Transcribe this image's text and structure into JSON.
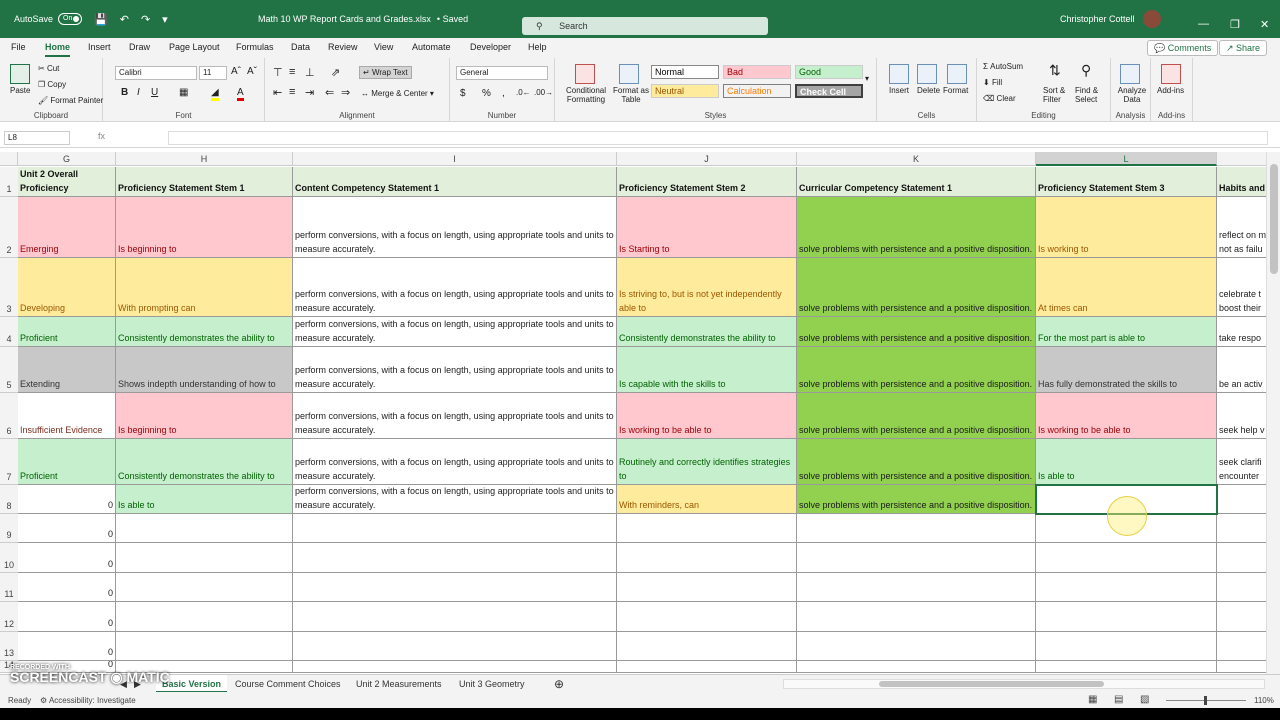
{
  "titlebar": {
    "autosave_label": "AutoSave",
    "autosave_state": "On",
    "file_title": "Math 10 WP Report Cards and Grades.xlsx",
    "saved_status": "• Saved",
    "search_placeholder": "Search",
    "user_name": "Christopher Cottell"
  },
  "menu": {
    "items": [
      "File",
      "Home",
      "Insert",
      "Draw",
      "Page Layout",
      "Formulas",
      "Data",
      "Review",
      "View",
      "Automate",
      "Developer",
      "Help"
    ],
    "comments_label": "Comments",
    "share_label": "Share"
  },
  "ribbon": {
    "clipboard": {
      "label": "Clipboard",
      "paste": "Paste",
      "cut": "Cut",
      "copy": "Copy",
      "format_painter": "Format Painter"
    },
    "font": {
      "label": "Font",
      "name": "Calibri",
      "size": "11"
    },
    "alignment": {
      "label": "Alignment",
      "wrap": "Wrap Text",
      "merge": "Merge & Center"
    },
    "number": {
      "label": "Number",
      "format": "General"
    },
    "styles": {
      "label": "Styles",
      "conditional": "Conditional Formatting",
      "format_table": "Format as Table",
      "normal": "Normal",
      "bad": "Bad",
      "good": "Good",
      "neutral": "Neutral",
      "calculation": "Calculation",
      "check_cell": "Check Cell"
    },
    "cells": {
      "label": "Cells",
      "insert": "Insert",
      "delete": "Delete",
      "format": "Format"
    },
    "editing": {
      "label": "Editing",
      "autosum": "AutoSum",
      "fill": "Fill",
      "clear": "Clear",
      "sort": "Sort & Filter",
      "find": "Find & Select"
    },
    "analysis": {
      "label": "Analysis",
      "analyze": "Analyze Data"
    },
    "addins": {
      "label": "Add-ins",
      "addins": "Add-ins"
    }
  },
  "formula_bar": {
    "name_box": "L8",
    "fx": "fx",
    "content": ""
  },
  "columns": [
    "G",
    "H",
    "I",
    "J",
    "K",
    "L"
  ],
  "column_m_partial": "",
  "header_row": {
    "G": "Unit 2 Overall Proficiency",
    "H": "Proficiency Statement Stem 1",
    "I": "Content Competency Statement 1",
    "J": "Proficiency Statement Stem 2",
    "K": "Curricular Competency Statement 1",
    "L": "Proficiency Statement Stem 3",
    "M": "Habits and"
  },
  "rows": [
    {
      "n": "2",
      "G": "Emerging",
      "H": "Is beginning to",
      "I": "perform conversions, with a focus on length, using appropriate tools and units to measure accurately.",
      "J": "Is Starting to",
      "K": "solve problems with persistence and a positive disposition.",
      "L": "Is working to",
      "M": "reflect on m not as failu"
    },
    {
      "n": "3",
      "G": "Developing",
      "H": "With prompting can",
      "I": "perform conversions, with a focus on length, using appropriate tools and units to measure accurately.",
      "J": "Is striving to, but is not yet independently able to",
      "K": "solve problems with persistence and a positive disposition.",
      "L": "At times can",
      "M": "celebrate t boost their"
    },
    {
      "n": "4",
      "G": "Proficient",
      "H": "Consistently demonstrates the ability to",
      "I": "perform conversions, with a focus on length, using appropriate tools and units to measure accurately.",
      "J": "Consistently demonstrates the ability to",
      "K": "solve problems with persistence and a positive disposition.",
      "L": "For the most part is able to",
      "M": "take respo"
    },
    {
      "n": "5",
      "G": "Extending",
      "H": "Shows indepth understanding of how to",
      "I": "perform conversions, with a focus on length, using appropriate tools and units to measure accurately.",
      "J": "Is capable with the skills to",
      "K": "solve problems with persistence and a positive disposition.",
      "L": "Has fully demonstrated the skills to",
      "M": "be an activ"
    },
    {
      "n": "6",
      "G": "Insufficient Evidence",
      "H": "Is beginning to",
      "I": "perform conversions, with a focus on length, using appropriate tools and units to measure accurately.",
      "J": "Is working to be able to",
      "K": "solve problems with persistence and a positive disposition.",
      "L": "Is working to be able to",
      "M": "seek help v"
    },
    {
      "n": "7",
      "G": "Proficient",
      "H": "Consistently demonstrates the ability to",
      "I": "perform conversions, with a focus on length, using appropriate tools and units to measure accurately.",
      "J": "Routinely and correctly identifies strategies to",
      "K": "solve problems with persistence and a positive disposition.",
      "L": "Is able to",
      "M": "seek clarifi encounter"
    },
    {
      "n": "8",
      "G": "0",
      "H": "Is able to",
      "I": "perform conversions, with a focus on length, using appropriate tools and units to measure accurately.",
      "J": "With reminders, can",
      "K": "solve problems with persistence and a positive disposition.",
      "L": "",
      "M": ""
    },
    {
      "n": "9",
      "G": "0"
    },
    {
      "n": "10",
      "G": "0"
    },
    {
      "n": "11",
      "G": "0"
    },
    {
      "n": "12",
      "G": "0"
    },
    {
      "n": "13",
      "G": "0"
    },
    {
      "n": "14",
      "G": "0"
    }
  ],
  "sheet_tabs": [
    "Basic Version",
    "Course Comment Choices",
    "Unit 2 Measurements",
    "Unit 3 Geometry"
  ],
  "active_tab": "Basic Version",
  "status": {
    "ready": "Ready",
    "accessibility": "Accessibility: Investigate",
    "zoom": "110%"
  },
  "watermark": {
    "line1": "RECORDED WITH",
    "line2": "SCREENCAST",
    "line3": "MATIC"
  }
}
